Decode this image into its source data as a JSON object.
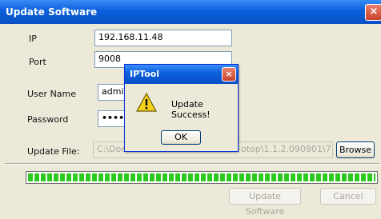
{
  "window": {
    "title": "Update Software",
    "close_glyph": "×"
  },
  "form": {
    "ip_label": "IP",
    "ip_value": "192.168.11.48",
    "port_label": "Port",
    "port_value": "9008",
    "user_label": "User Name",
    "user_value": "admin",
    "password_label": "Password",
    "password_value": "••••••",
    "file_label": "Update File:",
    "file_value": "C:\\Doc",
    "file_value_tail": "otop\\1.1.2.090801\\7",
    "browse_label": "Browse"
  },
  "progress": {
    "fraction": 1.0
  },
  "footer": {
    "update_label": "Update Software",
    "cancel_label": "Cancel"
  },
  "dialog": {
    "title": "IPTool",
    "close_glyph": "×",
    "message": "Update Success!",
    "ok_label": "OK",
    "icon": "warning-icon"
  },
  "colors": {
    "titlebar": "#0b5fdc",
    "progress": "#2ec91e",
    "close": "#c9432a"
  }
}
